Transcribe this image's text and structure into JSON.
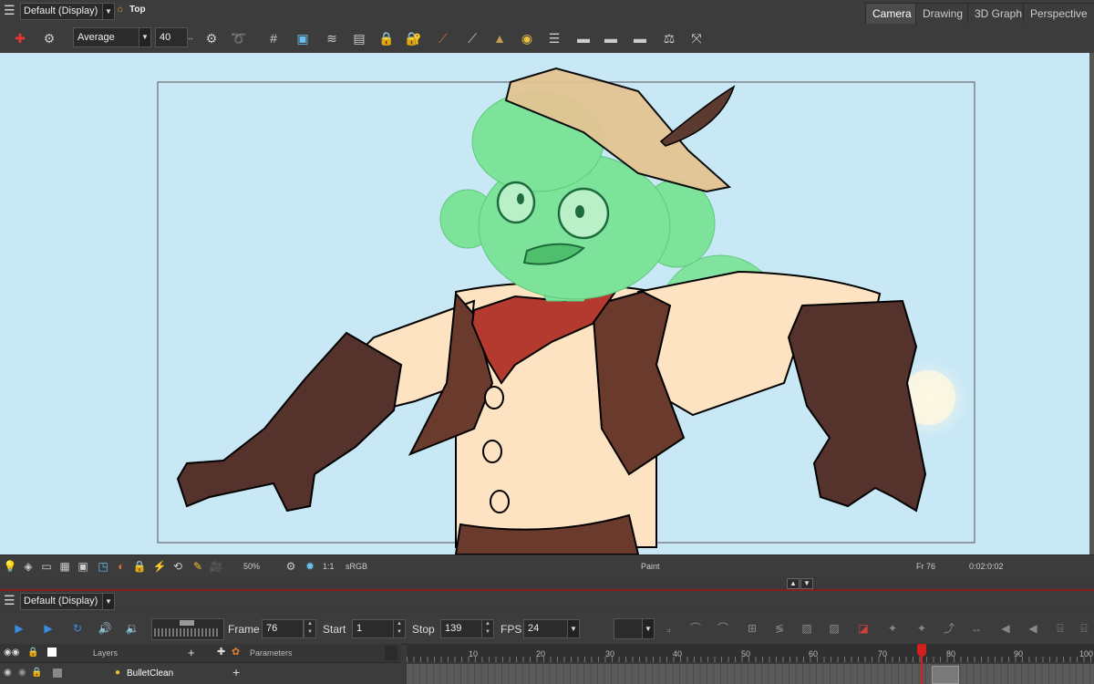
{
  "topbar": {
    "view_name": "Default (Display)",
    "location": "Top",
    "tabs": [
      "Camera",
      "Drawing",
      "3D Graph",
      "Perspective"
    ],
    "active_tab": "Camera"
  },
  "toolbar": {
    "smoothing_mode": "Average",
    "smoothing_value": "40"
  },
  "statusbar": {
    "zoom": "50%",
    "ratio": "1:1",
    "colorspace": "sRGB",
    "tool": "Paint",
    "frame": "Fr 76",
    "timecode": "0:02:0:02"
  },
  "timeline": {
    "view_name": "Default (Display)",
    "frame_label": "Frame",
    "frame_value": "76",
    "start_label": "Start",
    "start_value": "1",
    "stop_label": "Stop",
    "stop_value": "139",
    "fps_label": "FPS",
    "fps_value": "24",
    "layers_label": "Layers",
    "parameters_label": "Parameters",
    "layer_name": "BulletClean",
    "ticks": [
      "10",
      "20",
      "30",
      "40",
      "50",
      "60",
      "70",
      "80",
      "90",
      "100"
    ],
    "playhead": 76
  },
  "colors": {
    "sky": "#c9e8f6",
    "skin_green": "#7ee39a",
    "shirt": "#fde3c2",
    "vest": "#6a3b2c",
    "gloves": "#55332c",
    "bandana": "#b43a30",
    "hat": "#e4c594",
    "playhead": "#d02020"
  }
}
